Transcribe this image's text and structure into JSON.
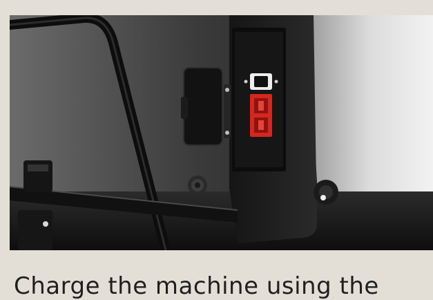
{
  "caption": {
    "text": "Charge the machine using the"
  },
  "photo": {
    "subject_icon": "charging-port-photo",
    "accent_color": "#d7261e",
    "background_color": "#e4dfd6"
  }
}
